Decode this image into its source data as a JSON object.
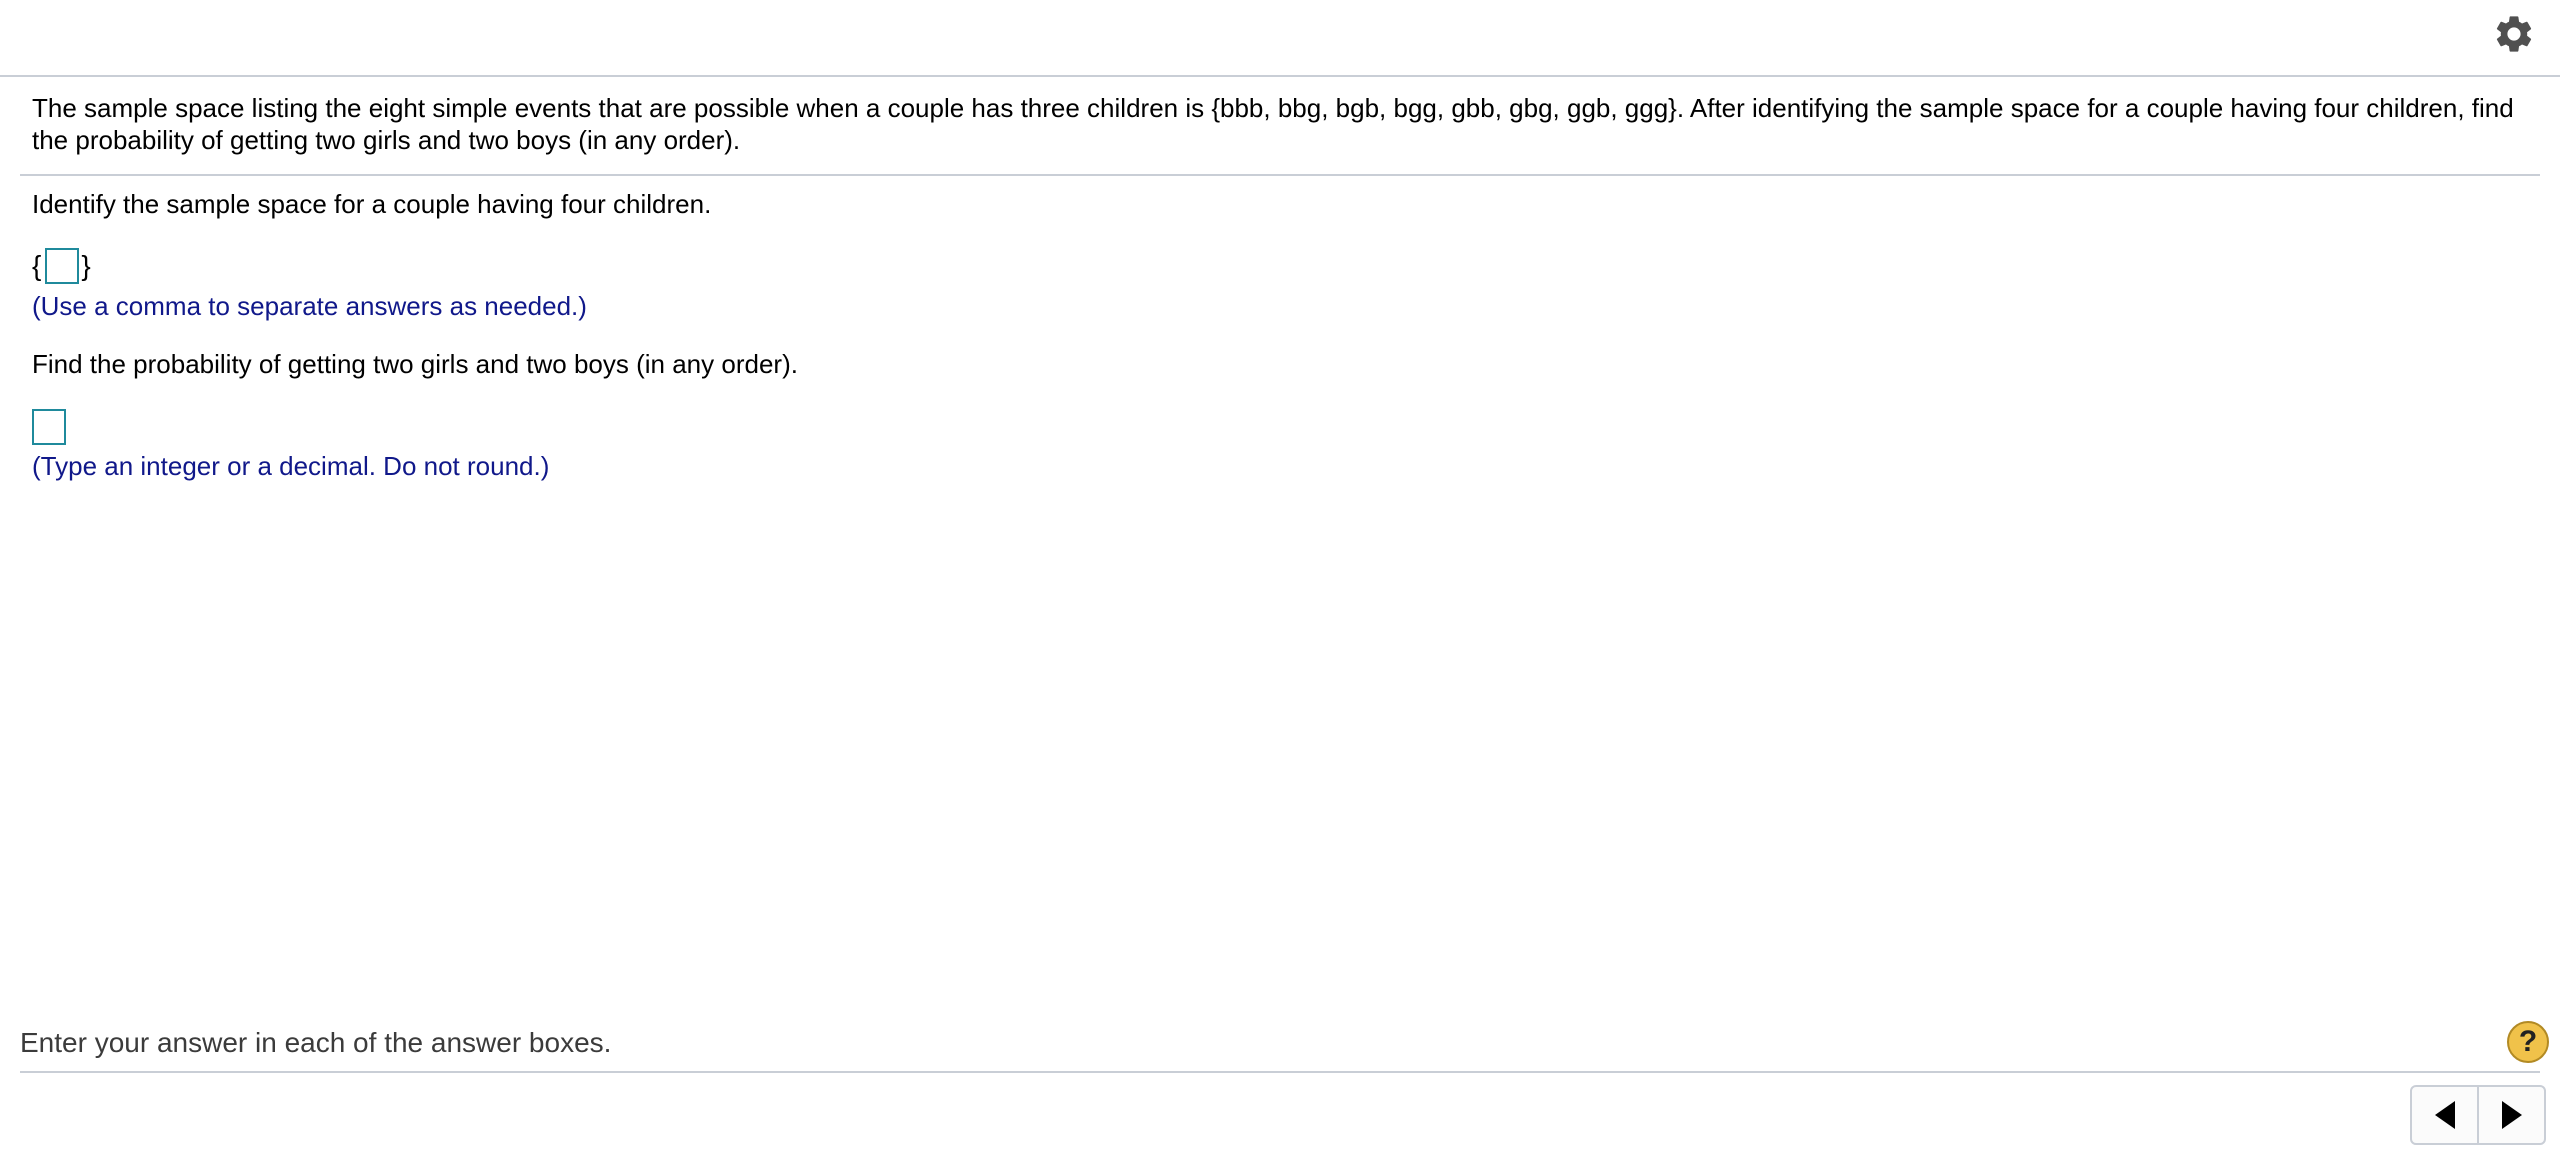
{
  "header": {
    "settings_icon": "gear-icon"
  },
  "question": {
    "stem": "The sample space listing the eight simple events that are possible when a couple has three children is {bbb, bbg, bgb, bgg, gbb, gbg, ggb, ggg}. After identifying the sample space for a couple having four children, find the probability of getting two girls and two boys (in any order).",
    "part1": {
      "prompt": "Identify the sample space for a couple having four children.",
      "open_brace": "{",
      "close_brace": "}",
      "answer_value": "",
      "hint": "(Use a comma to separate answers as needed.)"
    },
    "part2": {
      "prompt": "Find the probability of getting two girls and two boys (in any order).",
      "answer_value": "",
      "hint": "(Type an integer or a decimal. Do not round.)"
    }
  },
  "footer": {
    "message": "Enter your answer in each of the answer boxes.",
    "help_label": "?",
    "prev_icon": "triangle-left-icon",
    "next_icon": "triangle-right-icon"
  },
  "colors": {
    "hint_text": "#10188a",
    "answer_box_border": "#1f8a9c",
    "divider": "#c9ced6",
    "help_button": "#f0c24a"
  }
}
